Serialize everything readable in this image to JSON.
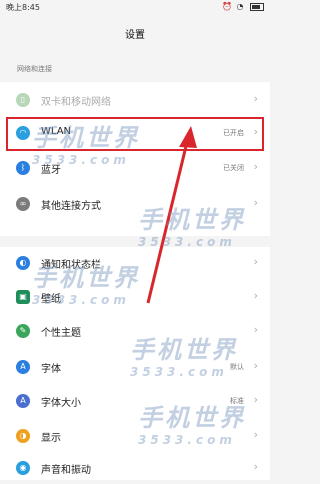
{
  "status_bar": {
    "time": "晚上8:45"
  },
  "page_title": "设置",
  "section_header": "网络和连接",
  "group1": [
    {
      "label": "双卡和移动网络",
      "value": "",
      "icon": "sim-card-icon",
      "color": "#8bc08a",
      "disabled": true
    },
    {
      "label": "WLAN",
      "value": "已开启",
      "icon": "wifi-icon",
      "color": "#2a9fe0"
    },
    {
      "label": "蓝牙",
      "value": "已关闭",
      "icon": "bluetooth-icon",
      "color": "#2a7fe0"
    },
    {
      "label": "其他连接方式",
      "value": "",
      "icon": "link-icon",
      "color": "#7c7c7c"
    }
  ],
  "group2": [
    {
      "label": "通知和状态栏",
      "value": "",
      "icon": "notification-icon",
      "color": "#2a7fe0"
    },
    {
      "label": "壁纸",
      "value": "",
      "icon": "wallpaper-icon",
      "color": "#1e8f5a"
    },
    {
      "label": "个性主题",
      "value": "",
      "icon": "theme-icon",
      "color": "#3aa65a"
    },
    {
      "label": "字体",
      "value": "默认",
      "icon": "font-icon",
      "color": "#2a7fe0"
    },
    {
      "label": "字体大小",
      "value": "标准",
      "icon": "font-size-icon",
      "color": "#4a6fd0"
    },
    {
      "label": "显示",
      "value": "",
      "icon": "display-icon",
      "color": "#f0a020"
    },
    {
      "label": "声音和振动",
      "value": "",
      "icon": "sound-icon",
      "color": "#2a9fe0"
    }
  ],
  "watermark": {
    "text": "手机世界",
    "sub": "3533.com"
  },
  "colors": {
    "highlight": "#d9262c",
    "arrow": "#d9262c"
  }
}
